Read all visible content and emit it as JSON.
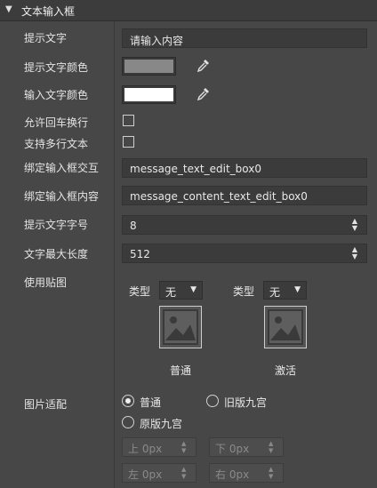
{
  "panel": {
    "collapse_glyph": "▼",
    "title": "文本输入框"
  },
  "fields": {
    "hint_text": {
      "label": "提示文字",
      "value": "请输入内容"
    },
    "hint_color": {
      "label": "提示文字颜色",
      "color": "#888888"
    },
    "input_color": {
      "label": "输入文字颜色",
      "color": "#ffffff"
    },
    "allow_enter": {
      "label": "允许回车换行",
      "checked": false
    },
    "multiline": {
      "label": "支持多行文本",
      "checked": false
    },
    "bind_interact": {
      "label": "绑定输入框交互",
      "value": "message_text_edit_box0"
    },
    "bind_content": {
      "label": "绑定输入框内容",
      "value": "message_content_text_edit_box0"
    },
    "hint_font_size": {
      "label": "提示文字字号",
      "value": "8"
    },
    "max_length": {
      "label": "文字最大长度",
      "value": "512"
    },
    "texture": {
      "label": "使用贴图",
      "normal": {
        "type_label": "类型",
        "type_value": "无",
        "caption": "普通"
      },
      "active": {
        "type_label": "类型",
        "type_value": "无",
        "caption": "激活"
      }
    },
    "image_fit": {
      "label": "图片适配",
      "options": [
        "普通",
        "旧版九宫",
        "原版九宫"
      ],
      "selected": "普通",
      "padding": {
        "top": {
          "label": "上",
          "value": "0px"
        },
        "bottom": {
          "label": "下",
          "value": "0px"
        },
        "left": {
          "label": "左",
          "value": "0px"
        },
        "right": {
          "label": "右",
          "value": "0px"
        }
      }
    }
  },
  "icons": {
    "collapse": "triangle-down",
    "color_picker": "eyedropper",
    "spinner": "up-down-arrows",
    "dropdown": "triangle-down",
    "image_placeholder": "image-icon"
  }
}
